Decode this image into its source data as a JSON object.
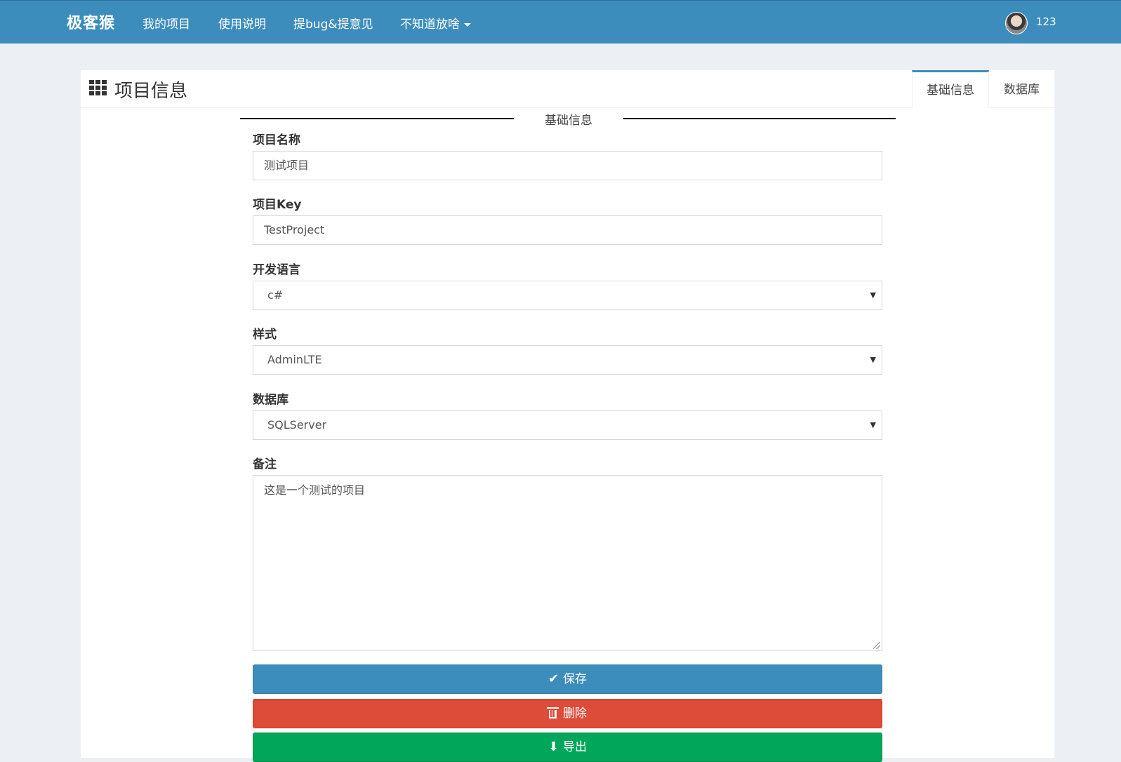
{
  "nav": {
    "brand": "极客猴",
    "items": [
      {
        "label": "我的项目"
      },
      {
        "label": "使用说明"
      },
      {
        "label": "提bug&提意见"
      },
      {
        "label": "不知道放啥"
      }
    ],
    "username": "123"
  },
  "panel": {
    "title": "项目信息",
    "tabs": [
      {
        "label": "基础信息",
        "active": true
      },
      {
        "label": "数据库",
        "active": false
      }
    ]
  },
  "form": {
    "legend": "基础信息",
    "project_name_label": "项目名称",
    "project_name_value": "测试项目",
    "project_key_label": "项目Key",
    "project_key_value": "TestProject",
    "language_label": "开发语言",
    "language_value": "c#",
    "style_label": "样式",
    "style_value": "AdminLTE",
    "database_label": "数据库",
    "database_value": "SQLServer",
    "remark_label": "备注",
    "remark_value": "这是一个测试的项目"
  },
  "buttons": {
    "save": "保存",
    "delete": "删除",
    "export": "导出"
  },
  "colors": {
    "header": "#3c8dbc",
    "save": "#3c8dbc",
    "delete": "#dd4b39",
    "export": "#00a65a"
  }
}
